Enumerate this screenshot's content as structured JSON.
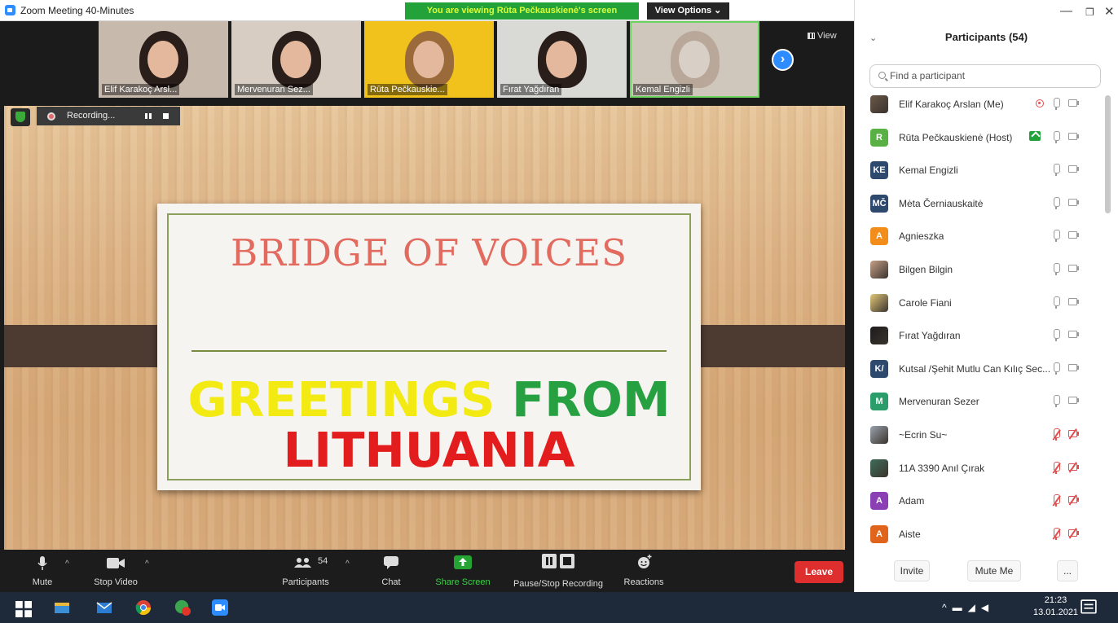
{
  "window": {
    "title": "Zoom Meeting 40-Minutes",
    "share_banner": "You are viewing Rūta Pečkauskienė's screen",
    "view_options": "View Options ⌄"
  },
  "thumbnails": [
    {
      "name": "Elif Karakoç Arsl...",
      "bg": "#c8b9ad"
    },
    {
      "name": "Mervenuran Sez...",
      "bg": "#d7cdc3"
    },
    {
      "name": "Rūta Pečkauskie...",
      "bg": "#f1c21b"
    },
    {
      "name": "Fırat Yağdıran",
      "bg": "#d9d9d6"
    },
    {
      "name": "Kemal Engizli",
      "bg": "#cfc6bc"
    }
  ],
  "view_label": "View",
  "recording": {
    "label": "Recording..."
  },
  "slide": {
    "title": "BRIDGE OF VOICES",
    "greetings_yellow": "GREETINGS",
    "greetings_green": "FROM",
    "country": "LITHUANIA"
  },
  "toolbar": {
    "mute": "Mute",
    "stop_video": "Stop Video",
    "participants": "Participants",
    "participants_count": "54",
    "chat": "Chat",
    "share_screen": "Share Screen",
    "pause_stop_recording": "Pause/Stop Recording",
    "reactions": "Reactions",
    "leave": "Leave"
  },
  "panel": {
    "title": "Participants (54)",
    "search_placeholder": "Find a participant",
    "participants": [
      {
        "name": "Elif Karakoç Arslan (Me)",
        "avatar": "",
        "color": "#6a5848",
        "photo": true,
        "muted": false,
        "recording": true
      },
      {
        "name": "Rūta Pečkauskienė (Host)",
        "avatar": "R",
        "color": "#59b044",
        "photo": false,
        "muted": false,
        "sharing": true
      },
      {
        "name": "Kemal Engizli",
        "avatar": "KE",
        "color": "#2d4a6e",
        "photo": false,
        "muted": false
      },
      {
        "name": "Mėta Černiauskaitė",
        "avatar": "MČ",
        "color": "#2d4a6e",
        "photo": false,
        "muted": false
      },
      {
        "name": "Agnieszka",
        "avatar": "A",
        "color": "#f28c1a",
        "photo": false,
        "muted": false
      },
      {
        "name": "Bilgen Bilgin",
        "avatar": "",
        "color": "#c7a089",
        "photo": true,
        "muted": false
      },
      {
        "name": "Carole Fiani",
        "avatar": "",
        "color": "#e3c87a",
        "photo": true,
        "muted": false
      },
      {
        "name": "Fırat Yağdıran",
        "avatar": "",
        "color": "#1c1c1c",
        "photo": true,
        "muted": false
      },
      {
        "name": "Kutsal /Şehit Mutlu Can Kılıç Sec...",
        "avatar": "K/",
        "color": "#2d4a6e",
        "photo": false,
        "muted": false
      },
      {
        "name": "Mervenuran Sezer",
        "avatar": "M",
        "color": "#2a9d6a",
        "photo": false,
        "muted": false
      },
      {
        "name": "~Ecrin Su~",
        "avatar": "",
        "color": "#9aa3ad",
        "photo": true,
        "muted": true
      },
      {
        "name": "11A 3390 Anıl Çırak",
        "avatar": "",
        "color": "#3f6d5a",
        "photo": true,
        "muted": true
      },
      {
        "name": "Adam",
        "avatar": "A",
        "color": "#8a3fb5",
        "photo": false,
        "muted": true
      },
      {
        "name": "Aiste",
        "avatar": "A",
        "color": "#e0641c",
        "photo": false,
        "muted": true
      }
    ],
    "invite": "Invite",
    "mute_me": "Mute Me",
    "more": "..."
  },
  "taskbar": {
    "time": "21:23",
    "date": "13.01.2021"
  },
  "colors": {
    "zoom_blue": "#2D8CFF",
    "leave_red": "#df2e2e",
    "share_green": "#23a23a"
  }
}
